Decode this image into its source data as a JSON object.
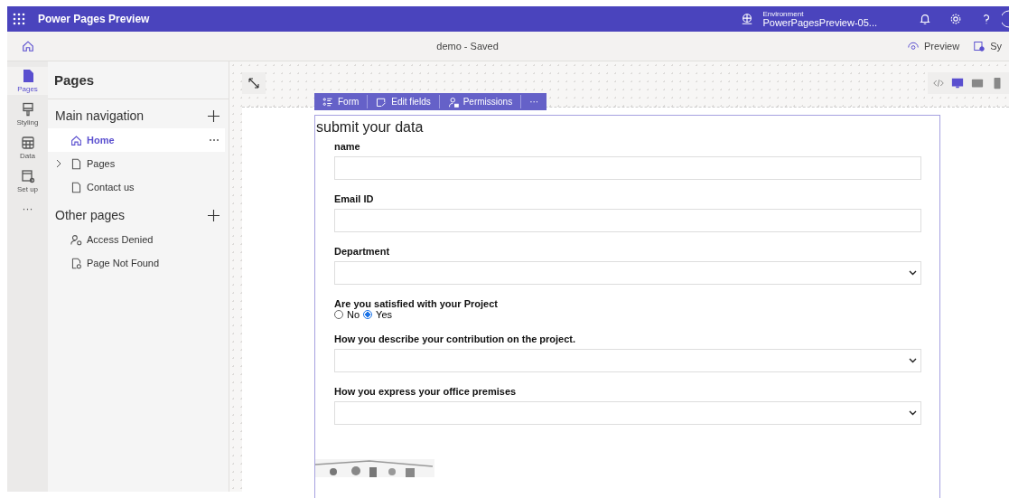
{
  "app_bar": {
    "title": "Power Pages Preview",
    "environment_label": "Environment",
    "environment_name": "PowerPagesPreview-05..."
  },
  "command_bar": {
    "document": "demo - Saved",
    "actions": [
      "Preview",
      "Sy"
    ]
  },
  "rail": [
    {
      "label": "Pages",
      "selected": true,
      "kind": "pages"
    },
    {
      "label": "Styling",
      "selected": false,
      "kind": "styling"
    },
    {
      "label": "Data",
      "selected": false,
      "kind": "data"
    },
    {
      "label": "Set up",
      "selected": false,
      "kind": "setup"
    },
    {
      "label": "···",
      "selected": false,
      "kind": "more"
    }
  ],
  "pages_panel": {
    "title": "Pages",
    "sections": [
      {
        "title": "Main navigation",
        "items": [
          {
            "label": "Home",
            "selected": true,
            "kind": "home",
            "expandable": false
          },
          {
            "label": "Pages",
            "selected": false,
            "kind": "page",
            "expandable": true
          },
          {
            "label": "Contact us",
            "selected": false,
            "kind": "page",
            "expandable": false
          }
        ]
      },
      {
        "title": "Other pages",
        "items": [
          {
            "label": "Access Denied",
            "selected": false,
            "kind": "denied",
            "expandable": false
          },
          {
            "label": "Page Not Found",
            "selected": false,
            "kind": "notfound",
            "expandable": false
          }
        ]
      }
    ]
  },
  "devices": [
    {
      "kind": "code",
      "selected": false
    },
    {
      "kind": "desktop",
      "selected": true
    },
    {
      "kind": "tablet",
      "selected": false
    },
    {
      "kind": "phone",
      "selected": false
    }
  ],
  "form_toolbar": [
    {
      "label": "Form",
      "kind": "form"
    },
    {
      "label": "Edit fields",
      "kind": "edit"
    },
    {
      "label": "Permissions",
      "kind": "perm"
    },
    {
      "label": "···",
      "kind": "more"
    }
  ],
  "form": {
    "title": "submit your data",
    "fields": [
      {
        "label": "name",
        "kind": "text"
      },
      {
        "label": "Email ID",
        "kind": "text"
      },
      {
        "label": "Department",
        "kind": "select"
      },
      {
        "label": "Are you satisfied with your Project",
        "kind": "radio",
        "options": [
          {
            "label": "No",
            "selected": false
          },
          {
            "label": "Yes",
            "selected": true
          }
        ]
      },
      {
        "label": "How you describe your contribution on the project.",
        "kind": "select"
      },
      {
        "label": "How you express your office premises",
        "kind": "select"
      }
    ]
  }
}
